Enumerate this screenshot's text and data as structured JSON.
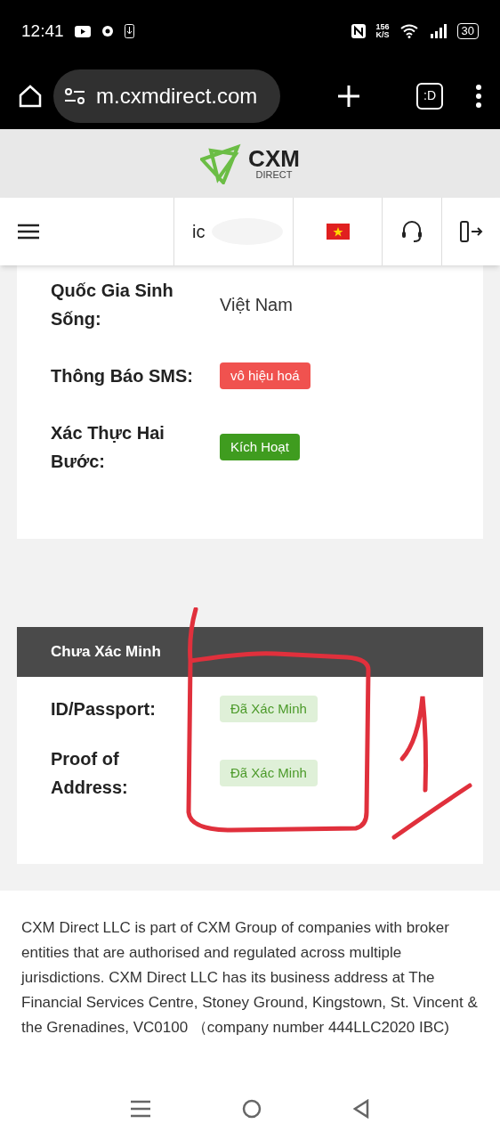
{
  "status_bar": {
    "time": "12:41",
    "speed": "156",
    "speed_unit": "K/S",
    "battery": "30"
  },
  "browser": {
    "url": "m.cxmdirect.com",
    "tabs_label": ":D"
  },
  "site_header": {
    "logo_title": "CXM",
    "logo_subtitle": "DIRECT"
  },
  "nav": {
    "account": "ic"
  },
  "profile_rows": [
    {
      "label": "Quốc Gia Sinh Sống:",
      "kind": "text",
      "value": "Việt Nam"
    },
    {
      "label": "Thông Báo SMS:",
      "kind": "badge",
      "color": "#f0524f",
      "value": "vô hiệu hoá"
    },
    {
      "label": "Xác Thực Hai Bước:",
      "kind": "badge",
      "color": "#3f9c1f",
      "value": "Kích Hoạt"
    }
  ],
  "verification": {
    "title": "Chưa Xác Minh",
    "rows": [
      {
        "label": "ID/Passport:",
        "color": "#dff0d8",
        "value": "Đã Xác Minh"
      },
      {
        "label": "Proof of Address:",
        "color": "#dff0d8",
        "value": "Đã Xác Minh"
      }
    ]
  },
  "footer": {
    "text": "CXM Direct LLC is part of CXM Group of companies with broker entities that are authorised and regulated across multiple jurisdictions. CXM Direct LLC has its business address at The Financial Services Centre, Stoney Ground, Kingstown, St. Vincent & the Grenadines, VC0100 （company number 444LLC2020 IBC)"
  }
}
